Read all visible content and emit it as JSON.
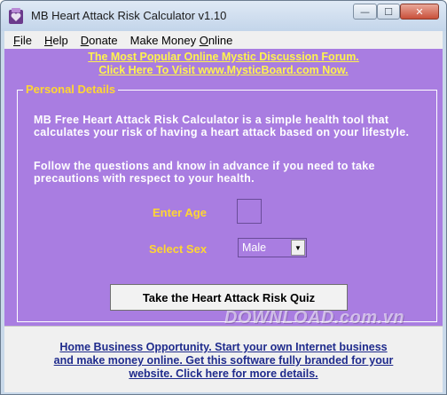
{
  "window": {
    "title": "MB Heart Attack Risk Calculator v1.10",
    "controls": {
      "minimize": "—",
      "maximize": "☐",
      "close": "✕"
    }
  },
  "menu": [
    {
      "label": "File",
      "hotkey": "F",
      "rest": "ile"
    },
    {
      "label": "Help",
      "hotkey": "H",
      "rest": "elp"
    },
    {
      "label": "Donate",
      "hotkey": "D",
      "rest": "onate"
    },
    {
      "label": "Make Money Online",
      "pre": "Make Money ",
      "hotkey": "O",
      "rest": "nline"
    }
  ],
  "promo_top": {
    "line1": "The Most Popular Online Mystic Discussion Forum.",
    "line2": "Click Here To Visit www.MysticBoard.com Now."
  },
  "personal_details": {
    "legend": "Personal Details",
    "description1": "MB Free Heart Attack Risk Calculator is a simple health tool that calculates your risk of having a heart attack based on your lifestyle.",
    "description2": "Follow the questions and know in advance if you need to take precautions with respect to your health.",
    "age_label": "Enter Age",
    "age_value": "",
    "sex_label": "Select Sex",
    "sex_value": "Male",
    "quiz_button": "Take the Heart Attack Risk Quiz"
  },
  "watermark": "DOWNLOAD.com.vn",
  "footer_promo": {
    "line1": "Home Business Opportunity. Start your own Internet business",
    "line2": "and make money online. Get this software fully branded for your",
    "line3": "website. Click here for more details."
  },
  "colors": {
    "panel": "#a97de1",
    "label_yellow": "#ffd633",
    "promo_yellow": "#fff34d",
    "footer_link": "#1f2b8c"
  }
}
